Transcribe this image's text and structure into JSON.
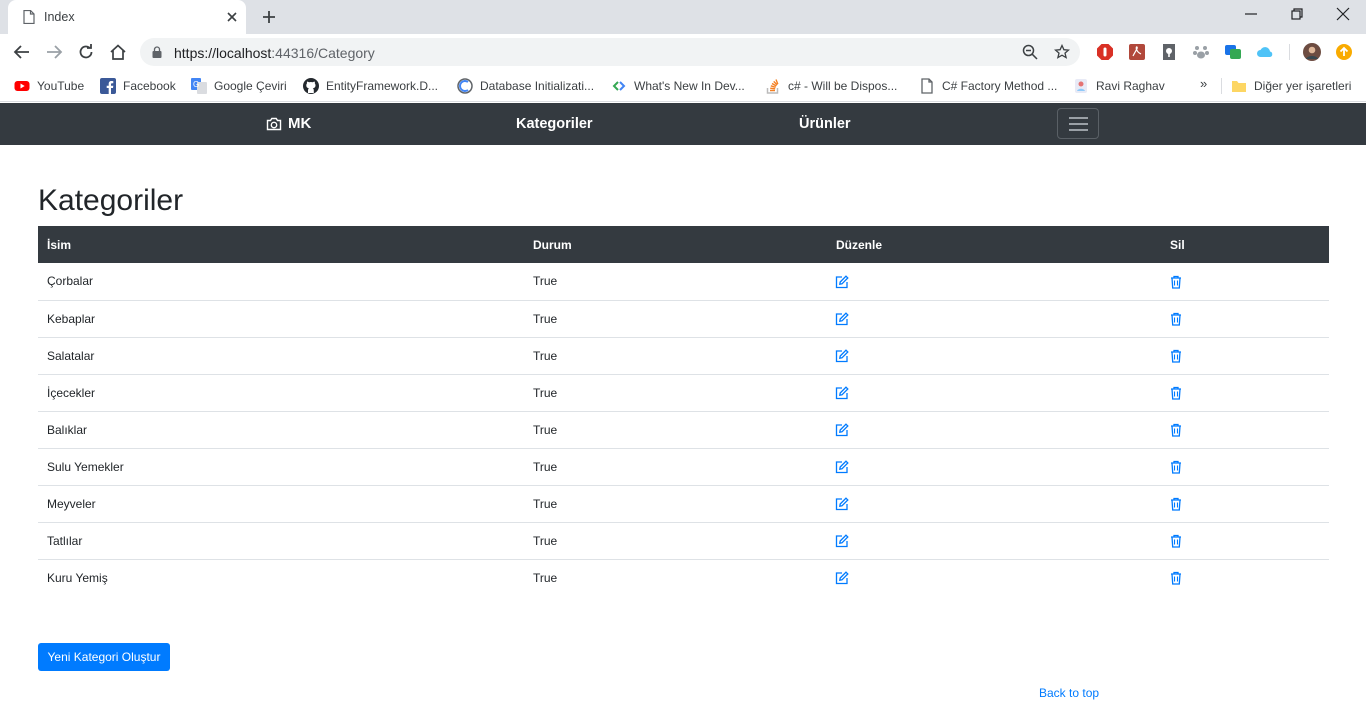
{
  "browser": {
    "tab_title": "Index",
    "url_host": "https://localhost",
    "url_rest": ":44316/Category",
    "bookmarks": [
      {
        "label": "YouTube",
        "icon": "youtube-icon"
      },
      {
        "label": "Facebook",
        "icon": "facebook-icon"
      },
      {
        "label": "Google Çeviri",
        "icon": "google-translate-icon"
      },
      {
        "label": "EntityFramework.D...",
        "icon": "github-icon"
      },
      {
        "label": "Database Initializati...",
        "icon": "globe-icon"
      },
      {
        "label": "What's New In Dev...",
        "icon": "chevrons-icon"
      },
      {
        "label": "c# - Will be Dispos...",
        "icon": "stackoverflow-icon"
      },
      {
        "label": "C# Factory Method ...",
        "icon": "page-icon"
      },
      {
        "label": "Ravi Raghav",
        "icon": "profile-icon"
      }
    ],
    "bookmarks_more": "»",
    "other_bookmarks": "Diğer yer işaretleri"
  },
  "navbar": {
    "brand": "MK",
    "links": [
      "Kategoriler",
      "Ürünler"
    ]
  },
  "page": {
    "title": "Kategoriler",
    "columns": [
      "İsim",
      "Durum",
      "Düzenle",
      "Sil"
    ],
    "rows": [
      {
        "name": "Çorbalar",
        "status": "True"
      },
      {
        "name": "Kebaplar",
        "status": "True"
      },
      {
        "name": "Salatalar",
        "status": "True"
      },
      {
        "name": "İçecekler",
        "status": "True"
      },
      {
        "name": "Balıklar",
        "status": "True"
      },
      {
        "name": "Sulu Yemekler",
        "status": "True"
      },
      {
        "name": "Meyveler",
        "status": "True"
      },
      {
        "name": "Tatlılar",
        "status": "True"
      },
      {
        "name": "Kuru Yemiş",
        "status": "True"
      }
    ],
    "create_button": "Yeni Kategori Oluştur",
    "back_to_top": "Back to top"
  },
  "colors": {
    "navbar": "#343a40",
    "primary": "#007bff",
    "link": "#007bff"
  }
}
